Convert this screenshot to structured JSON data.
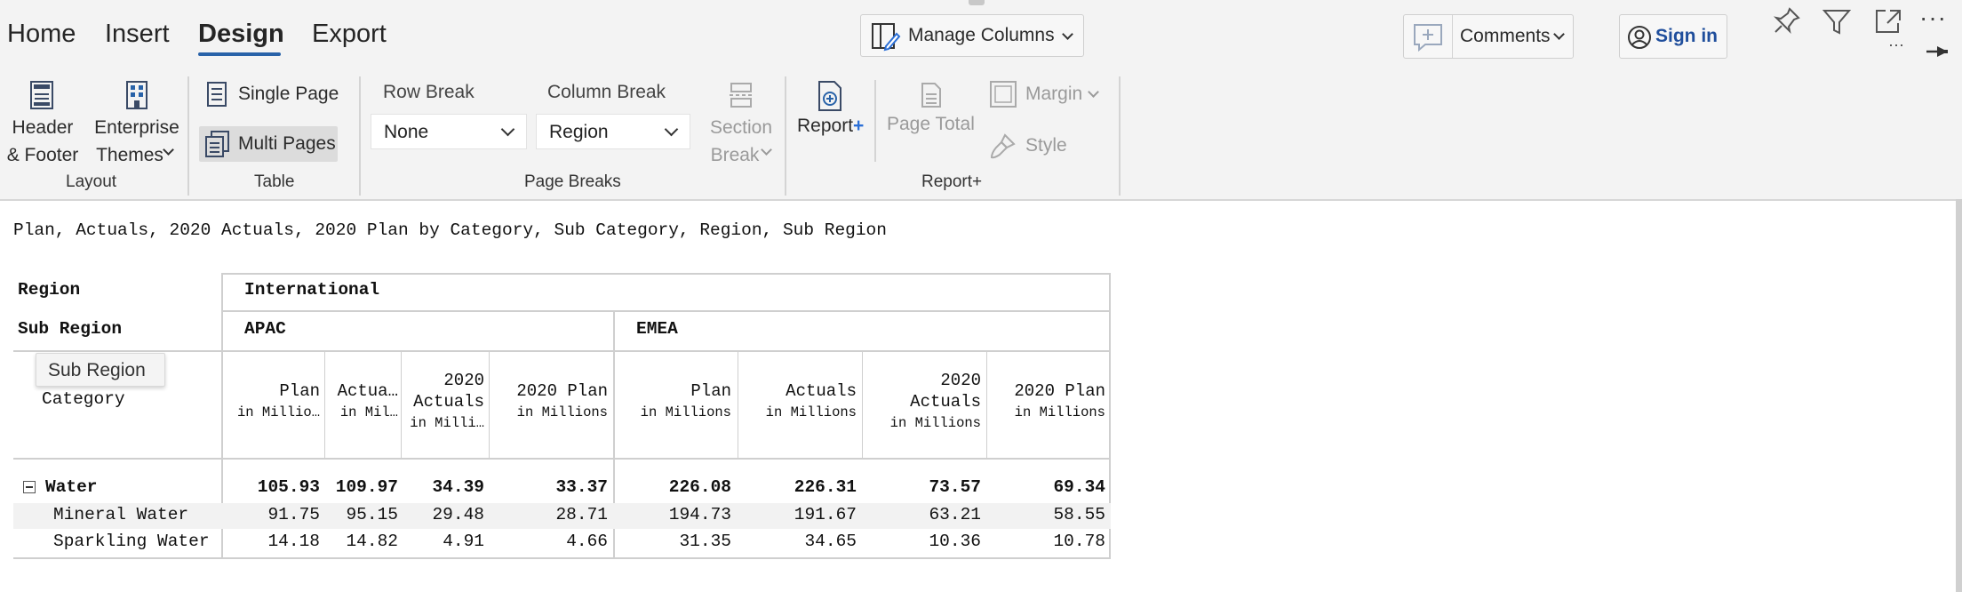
{
  "ribbon": {
    "tabs": [
      {
        "label": "Home"
      },
      {
        "label": "Insert"
      },
      {
        "label": "Design",
        "active": true
      },
      {
        "label": "Export"
      }
    ],
    "manage_columns": "Manage Columns",
    "comments": "Comments",
    "sign_in": "Sign in",
    "more": "···",
    "layout": {
      "header_footer_1": "Header",
      "header_footer_2": "& Footer",
      "themes_1": "Enterprise",
      "themes_2": "Themes",
      "group": "Layout"
    },
    "table": {
      "single_page": "Single Page",
      "multi_pages": "Multi Pages",
      "group": "Table"
    },
    "page_breaks": {
      "row_break_label": "Row Break",
      "row_break_value": "None",
      "column_break_label": "Column Break",
      "column_break_value": "Region",
      "section_break_1": "Section",
      "section_break_2": "Break",
      "group": "Page Breaks"
    },
    "report_plus": {
      "report": "Report",
      "plus": "+",
      "page_total": "Page Total",
      "margin": "Margin",
      "style": "Style",
      "group": "Report+"
    }
  },
  "report": {
    "description": "Plan, Actuals, 2020 Actuals, 2020 Plan by Category, Sub Category, Region, Sub Region",
    "row_headers": {
      "region": "Region",
      "sub_region": "Sub Region",
      "category": "Category"
    },
    "tooltip": "Sub Region",
    "region_value": "International",
    "sub_regions": [
      "APAC",
      "EMEA"
    ],
    "columns": [
      {
        "name": "Plan",
        "unit": "in Millio…"
      },
      {
        "name": "Actua…",
        "unit": "in Mil…"
      },
      {
        "name_1": "2020",
        "name_2": "Actuals",
        "unit": "in Milli…"
      },
      {
        "name": "2020 Plan",
        "unit": "in Millions"
      },
      {
        "name": "Plan",
        "unit": "in Millions"
      },
      {
        "name": "Actuals",
        "unit": "in Millions"
      },
      {
        "name_1": "2020",
        "name_2": "Actuals",
        "unit": "in Millions"
      },
      {
        "name": "2020 Plan",
        "unit": "in Millions"
      }
    ],
    "rows": [
      {
        "label": "Water",
        "collapse": "−",
        "values": [
          "105.93",
          "109.97",
          "34.39",
          "33.37",
          "226.08",
          "226.31",
          "73.57",
          "69.34"
        ]
      },
      {
        "label": "Mineral Water",
        "values": [
          "91.75",
          "95.15",
          "29.48",
          "28.71",
          "194.73",
          "191.67",
          "63.21",
          "58.55"
        ]
      },
      {
        "label": "Sparkling Water",
        "values": [
          "14.18",
          "14.82",
          "4.91",
          "4.66",
          "31.35",
          "34.65",
          "10.36",
          "10.78"
        ]
      }
    ]
  },
  "colors": {
    "accent": "#2862a8",
    "sign_in": "#1f4e9c",
    "plus": "#2b6fd6"
  },
  "icons": [
    "header-footer-icon",
    "enterprise-themes-icon",
    "single-page-icon",
    "multi-pages-icon",
    "section-break-icon",
    "report-plus-icon",
    "page-total-icon",
    "margin-icon",
    "style-brush-icon",
    "manage-columns-icon",
    "comment-add-icon",
    "user-icon",
    "pin-icon",
    "filter-icon",
    "expand-icon",
    "more-icon"
  ]
}
